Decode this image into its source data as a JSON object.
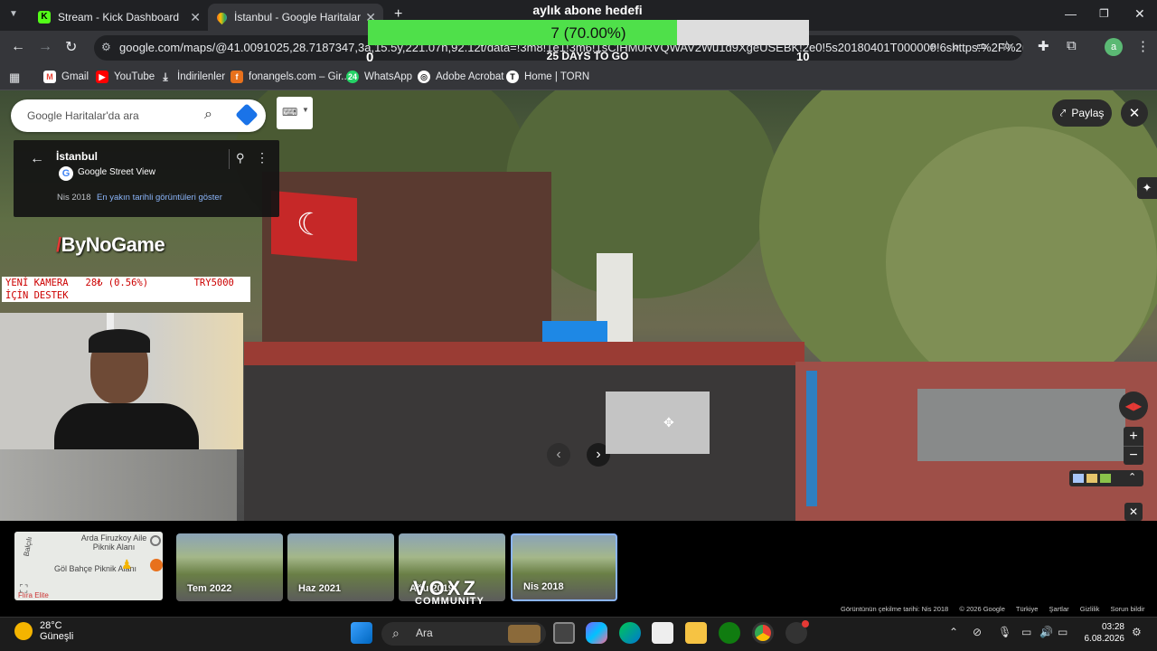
{
  "browser": {
    "tabs": [
      {
        "label": "Stream - Kick Dashboard",
        "color": "#53fc18"
      },
      {
        "label": "İstanbul - Google Haritalar",
        "color": "#34a853"
      }
    ],
    "url": "google.com/maps/@41.0091025,28.7187347,3a,15.5y,221.07h,92.12t/data=!3m8!1e1!3m6!1sCIHM0RVQWAV2Wu1d9XgeUSEBK!2e0!5s20180401T000000!6shttps:%2F%2Fstreetvi...",
    "bookmarks": [
      "Gmail",
      "YouTube",
      "İndirilenler",
      "fonangels.com – Gir...",
      "WhatsApp",
      "Adobe Acrobat",
      "Home | TORN"
    ],
    "profile_initial": "a"
  },
  "goal": {
    "title": "aylık abone hedefi",
    "progress_text": "7 (70.00%)",
    "progress": 0.7,
    "min": "0",
    "max": "10",
    "days_left": "25 DAYS TO GO",
    "fill_color": "#4fe04a"
  },
  "maps": {
    "search_placeholder": "Google Haritalar'da ara",
    "place_title": "İstanbul",
    "place_source": "Google Street View",
    "date": "Nis 2018",
    "latest_link": "En yakın tarihli görüntüleri göster",
    "share_label": "Paylaş",
    "timeline": [
      {
        "label": "Tem 2022"
      },
      {
        "label": "Haz 2021"
      },
      {
        "label": "Ağu 2019"
      },
      {
        "label": "Nis 2018",
        "selected": true
      }
    ],
    "minimap_labels": [
      "Arda Firuzkoy Aile Piknik Alanı",
      "Göl Bahçe Piknik Alanı",
      "Balçılı",
      "Flıra Elite"
    ],
    "footer": [
      "Görüntünün çekilme tarihi: Nis 2018",
      "© 2026 Google",
      "Türkiye",
      "Şartlar",
      "Gizlilik",
      "Sorun bildir"
    ]
  },
  "overlay": {
    "brand": "ByNoGame",
    "donation_line1": "YENİ KAMERA   28₺ (0.56%)        TRY5000",
    "donation_line2": "İÇİN DESTEK",
    "community": "VOXZ",
    "community_sub": "COMMUNITY"
  },
  "taskbar": {
    "weather_temp": "28°C",
    "weather_desc": "Güneşli",
    "search_label": "Ara",
    "time": "03:28",
    "date": "6.08.2026"
  }
}
